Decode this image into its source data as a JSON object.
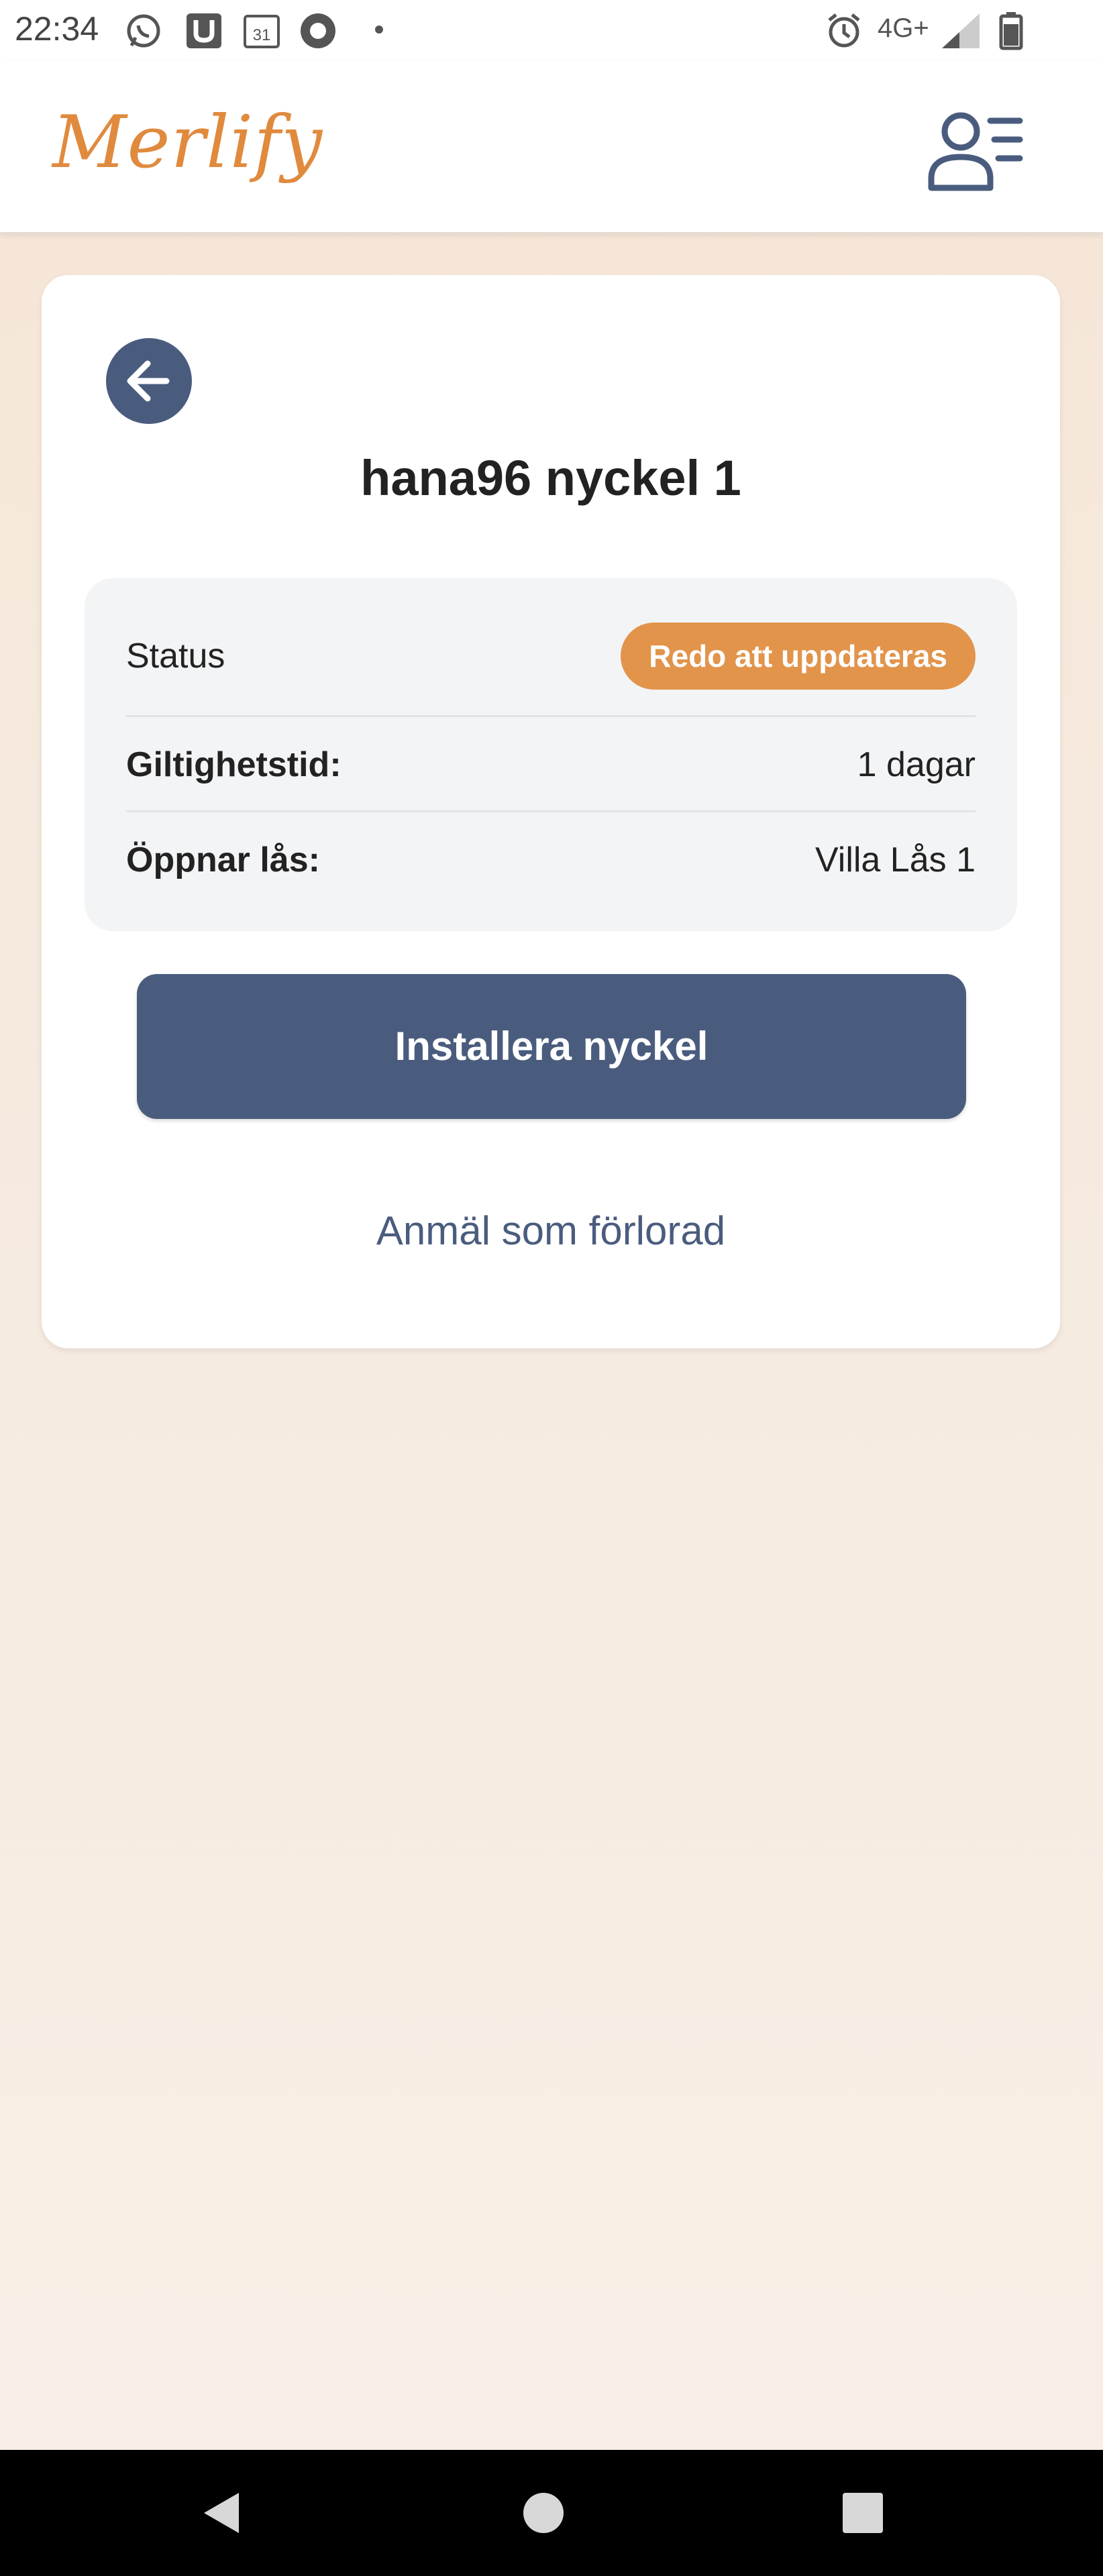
{
  "status_bar": {
    "time": "22:34",
    "network": "4G+",
    "icons": [
      "whatsapp-icon",
      "u-app-icon",
      "calendar-icon",
      "record-icon",
      "dot-icon",
      "alarm-icon",
      "signal-icon",
      "battery-icon"
    ],
    "calendar_day": "31"
  },
  "header": {
    "logo": "Merlify",
    "profile_icon": "user-menu-icon"
  },
  "key_card": {
    "title": "hana96 nyckel 1",
    "status": {
      "label": "Status",
      "value": "Redo att uppdateras"
    },
    "validity": {
      "label": "Giltighetstid:",
      "value": "1 dagar"
    },
    "opens_lock": {
      "label": "Öppnar lås:",
      "value": "Villa Lås 1"
    },
    "install_button": "Installera nyckel",
    "report_lost_link": "Anmäl som förlorad"
  },
  "colors": {
    "primary": "#4a5c7e",
    "accent": "#e2944b",
    "logo": "#e08a3e",
    "background": "#f6eadf"
  }
}
